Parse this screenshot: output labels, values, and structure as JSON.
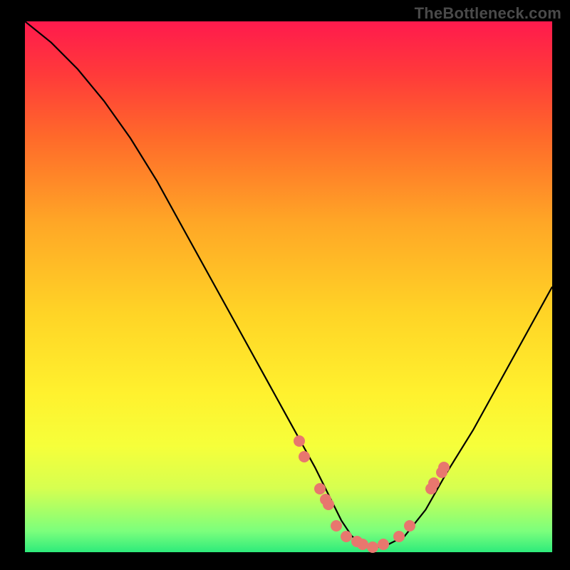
{
  "attribution": "TheBottleneck.com",
  "chart_data": {
    "type": "line",
    "title": "",
    "xlabel": "",
    "ylabel": "",
    "xlim": [
      0,
      100
    ],
    "ylim": [
      0,
      100
    ],
    "grid": false,
    "legend": false,
    "series": [
      {
        "name": "bottleneck-curve",
        "x": [
          0,
          5,
          10,
          15,
          20,
          25,
          30,
          35,
          40,
          45,
          50,
          55,
          58,
          60,
          62,
          65,
          68,
          72,
          76,
          80,
          85,
          90,
          95,
          100
        ],
        "y": [
          100,
          96,
          91,
          85,
          78,
          70,
          61,
          52,
          43,
          34,
          25,
          16,
          10,
          6,
          3,
          1,
          1,
          3,
          8,
          15,
          23,
          32,
          41,
          50
        ]
      }
    ],
    "scatter": {
      "name": "highlighted-points",
      "color": "#e8776e",
      "points": [
        {
          "x": 52,
          "y": 21
        },
        {
          "x": 53,
          "y": 18
        },
        {
          "x": 56,
          "y": 12
        },
        {
          "x": 57,
          "y": 10
        },
        {
          "x": 57.5,
          "y": 9
        },
        {
          "x": 59,
          "y": 5
        },
        {
          "x": 61,
          "y": 3
        },
        {
          "x": 63,
          "y": 2
        },
        {
          "x": 64,
          "y": 1.5
        },
        {
          "x": 66,
          "y": 1
        },
        {
          "x": 68,
          "y": 1.5
        },
        {
          "x": 71,
          "y": 3
        },
        {
          "x": 73,
          "y": 5
        },
        {
          "x": 77,
          "y": 12
        },
        {
          "x": 77.5,
          "y": 13
        },
        {
          "x": 79,
          "y": 15
        },
        {
          "x": 79.5,
          "y": 16
        }
      ]
    },
    "background_gradient": {
      "top": "#ff1a4d",
      "bottom": "#2eeb7b"
    }
  }
}
